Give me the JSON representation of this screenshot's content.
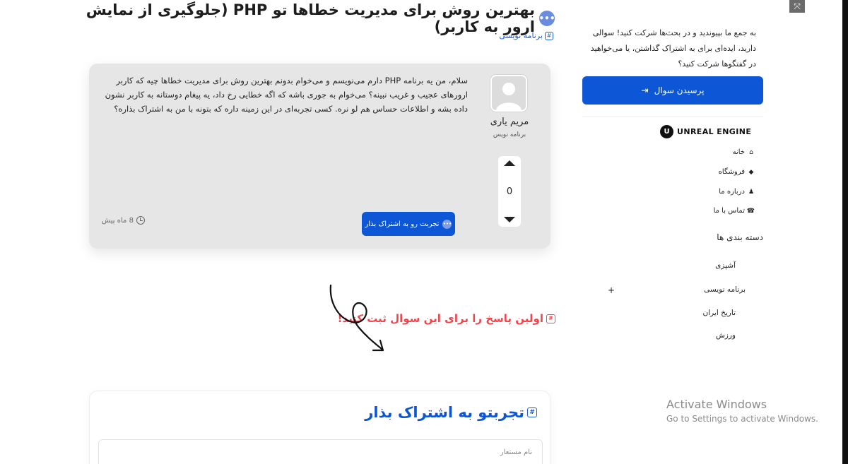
{
  "question": {
    "title": "بهترین روش برای مدیریت خطاها تو PHP (جلوگیری از نمایش ارور به کاربر)",
    "category_tag": "برنامه نویسی",
    "author_name": "مریم یاری",
    "author_role": "برنامه نویس",
    "body": "سلام، من یه برنامه PHP دارم می‌نویسم و می‌خوام بدونم بهترین روش برای مدیریت خطاها چیه که کاربر ارورهای عجیب و غریب نبینه؟ می‌خوام به جوری باشه که اگه خطایی رخ داد، یه پیغام دوستانه به کاربر نشون داده بشه و اطلاعات حساس هم لو نره. کسی تجربه‌ای در این زمینه داره که بتونه با من به اشتراک بذاره؟",
    "vote_count": "0",
    "share_button_label": "تجربت رو به اشتراک بذار",
    "time_ago": "8 ماه پیش"
  },
  "first_answer_prompt": "اولین پاسخ را برای این سوال ثبت کنید!",
  "share_form": {
    "title": "تجربتو به اشتراک بذار",
    "name_placeholder": "نام مستعار"
  },
  "sidebar": {
    "join_text": "به جمع ما بپیوندید و در بحث‌ها شرکت کنید! سوالی دارید، ایده‌ای برای به اشتراک گذاشتن، یا می‌خواهید در گفتگوها شرکت کنید؟",
    "ask_button_label": "پرسیدن سوال",
    "logo_text": "UNREAL ENGINE",
    "nav": [
      {
        "label": "خانه",
        "icon": "home-icon"
      },
      {
        "label": "فروشگاه",
        "icon": "tag-icon"
      },
      {
        "label": "درباره ما",
        "icon": "users-icon"
      },
      {
        "label": "تماس با ما",
        "icon": "phone-icon"
      }
    ],
    "categories_heading": "دسته بندی ها",
    "categories": [
      "آشپزی",
      "برنامه نویسی",
      "تاریخ ایران",
      "ورزش"
    ],
    "expand_symbol": "+"
  },
  "os_watermark": {
    "line1": "Activate Windows",
    "line2": "Go to Settings to activate Windows."
  },
  "colors": {
    "primary": "#0d57d6",
    "accent_red": "#f0454b",
    "card_bg": "#e6e6e7"
  }
}
